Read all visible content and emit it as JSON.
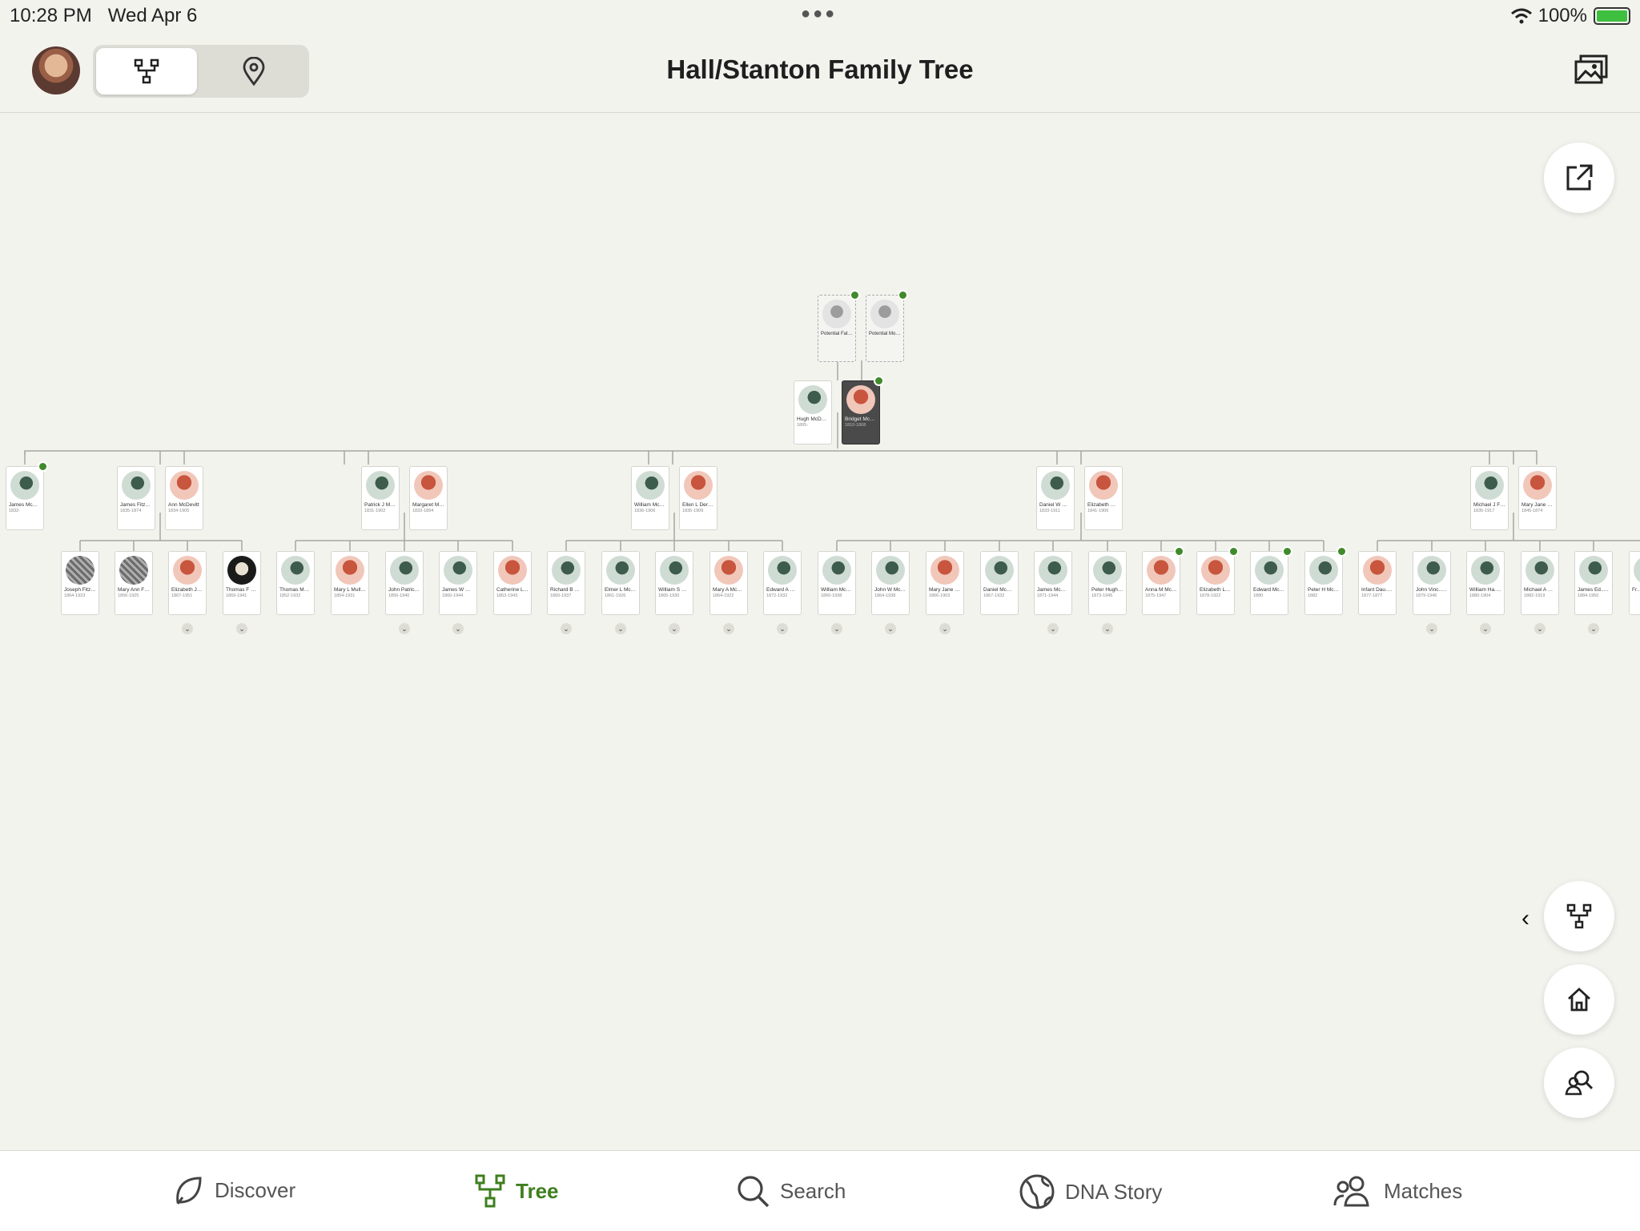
{
  "status": {
    "time": "10:28 PM",
    "date": "Wed Apr 6",
    "battery": "100%"
  },
  "header": {
    "title": "Hall/Stanton Family Tree"
  },
  "potential_parents": [
    {
      "name": "Potential Father"
    },
    {
      "name": "Potential Mother"
    }
  ],
  "root_couple": [
    {
      "name": "Hugh McDevitt",
      "years": "1805-",
      "gender": "m"
    },
    {
      "name": "Bridget McDevitt",
      "years": "1810-1868",
      "gender": "f"
    }
  ],
  "children": [
    {
      "name": "James McDevitt",
      "years": "1832-",
      "gender": "m"
    },
    {
      "name": "James Fitzsimmo...",
      "years": "1835-1874",
      "gender": "m"
    },
    {
      "name": "Ann McDevitt",
      "years": "1834-1905",
      "gender": "f"
    },
    {
      "name": "Patrick J Mullady",
      "years": "1831-1902",
      "gender": "m"
    },
    {
      "name": "Margaret McDevitt",
      "years": "1833-1894",
      "gender": "f"
    },
    {
      "name": "William McDevitt",
      "years": "1836-1906",
      "gender": "m"
    },
    {
      "name": "Ellen L Derrick",
      "years": "1835-1909",
      "gender": "f"
    },
    {
      "name": "Daniel W McWilliams",
      "years": "1833-1911",
      "gender": "m"
    },
    {
      "name": "Elizabeth M McDevitt",
      "years": "1841-1906",
      "gender": "f"
    },
    {
      "name": "Michael J Fleming",
      "years": "1835-1917",
      "gender": "m"
    },
    {
      "name": "Mary Jane McDevitt",
      "years": "1845-1874",
      "gender": "f"
    }
  ],
  "grandchildren": [
    {
      "name": "Joseph Fitzsimmo...",
      "years": "1864-1923",
      "gender": "p1"
    },
    {
      "name": "Mary Ann Fitzsimmo...",
      "years": "1856-1925",
      "gender": "p1"
    },
    {
      "name": "Elizabeth J Fitzsimmo...",
      "years": "1867-1951",
      "gender": "f"
    },
    {
      "name": "Thomas F Fitzsimmo...",
      "years": "1869-1941",
      "gender": "p2"
    },
    {
      "name": "Thomas Mullady",
      "years": "1852-1932",
      "gender": "m"
    },
    {
      "name": "Mary L Mullady",
      "years": "1854-1931",
      "gender": "f"
    },
    {
      "name": "John Patrick Mullady Sr",
      "years": "1856-1940",
      "gender": "m"
    },
    {
      "name": "James W Mullady",
      "years": "1860-1944",
      "gender": "m"
    },
    {
      "name": "Catherine L Mullady",
      "years": "1863-1943",
      "gender": "f"
    },
    {
      "name": "Richard B McDevitt",
      "years": "1860-1937",
      "gender": "m"
    },
    {
      "name": "Elmer L McDevitt",
      "years": "1861-1926",
      "gender": "m"
    },
    {
      "name": "William S McDevitt",
      "years": "1865-1930",
      "gender": "m"
    },
    {
      "name": "Mary A McDevitt",
      "years": "1864-1922",
      "gender": "f"
    },
    {
      "name": "Edward A McDevitt",
      "years": "1872-1932",
      "gender": "m"
    },
    {
      "name": "William McWilliams",
      "years": "1860-1938",
      "gender": "m"
    },
    {
      "name": "John W McWilliam...",
      "years": "1864-1938",
      "gender": "m"
    },
    {
      "name": "Mary Jane McWilliams",
      "years": "1866-1903",
      "gender": "f"
    },
    {
      "name": "Daniel McWilliams",
      "years": "1867-1932",
      "gender": "m"
    },
    {
      "name": "James McWilliams",
      "years": "1871-1944",
      "gender": "m"
    },
    {
      "name": "Peter Hugh McWilliams",
      "years": "1873-1945",
      "gender": "m"
    },
    {
      "name": "Anna M McWilliams",
      "years": "1875-1947",
      "gender": "f"
    },
    {
      "name": "Elizabeth L McWilliams",
      "years": "1878-1922",
      "gender": "f"
    },
    {
      "name": "Edward McWilliams",
      "years": "1880",
      "gender": "m"
    },
    {
      "name": "Peter H McWilliams",
      "years": "1882",
      "gender": "m"
    },
    {
      "name": "Infant Dau... Fleming",
      "years": "1877-1877",
      "gender": "f"
    },
    {
      "name": "John Vinc... Fleming",
      "years": "1879-1946",
      "gender": "m"
    },
    {
      "name": "William Ha... Fleming",
      "years": "1880-1904",
      "gender": "m"
    },
    {
      "name": "Michael A Fleming",
      "years": "1882-1919",
      "gender": "m"
    },
    {
      "name": "James Ed... Fleming",
      "years": "1884-1950",
      "gender": "m"
    },
    {
      "name": "Fr... Fle...",
      "years": "",
      "gender": "m"
    }
  ],
  "nav": {
    "discover": "Discover",
    "tree": "Tree",
    "search": "Search",
    "dna": "DNA Story",
    "matches": "Matches"
  },
  "colors": {
    "accent": "#3f7f1f",
    "hint_leaf": "#3f8a2a",
    "female": "#c8553d",
    "male": "#3e5c4c"
  }
}
